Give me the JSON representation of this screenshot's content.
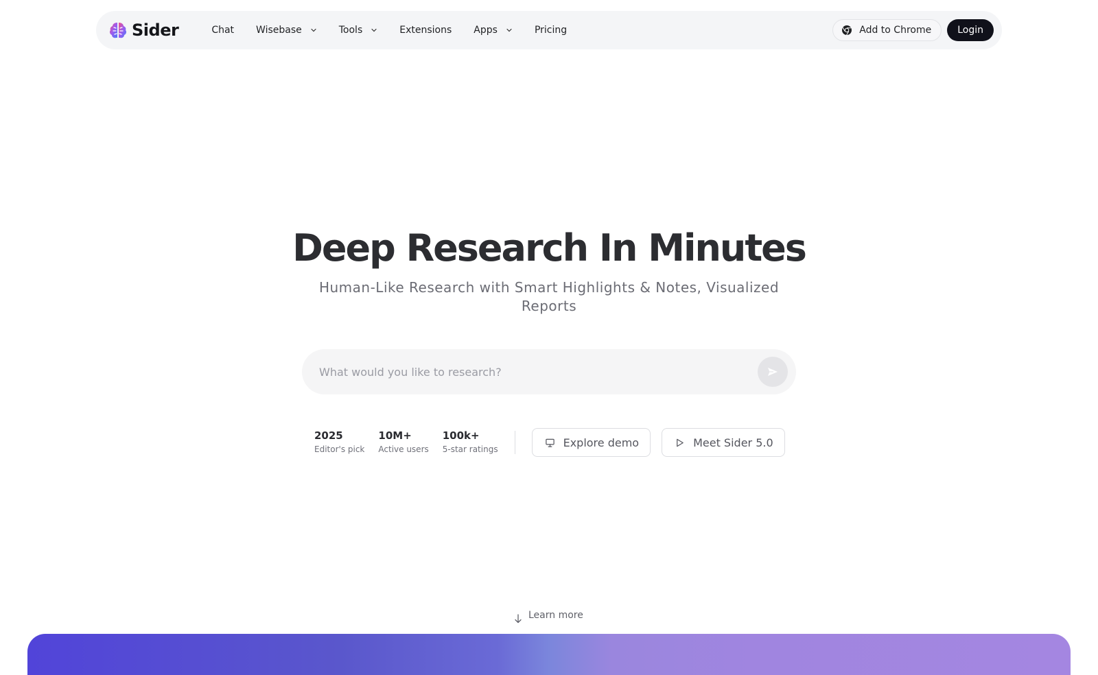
{
  "brand": {
    "name": "Sider",
    "logo_icon": "brain-logo-icon"
  },
  "nav": {
    "items": [
      {
        "label": "Chat",
        "has_dropdown": false
      },
      {
        "label": "Wisebase",
        "has_dropdown": true
      },
      {
        "label": "Tools",
        "has_dropdown": true
      },
      {
        "label": "Extensions",
        "has_dropdown": false
      },
      {
        "label": "Apps",
        "has_dropdown": true
      },
      {
        "label": "Pricing",
        "has_dropdown": false
      }
    ],
    "add_to_chrome": "Add to Chrome",
    "login": "Login"
  },
  "hero": {
    "title": "Deep Research In Minutes",
    "subtitle": "Human-Like Research with Smart Highlights & Notes, Visualized Reports"
  },
  "search": {
    "value": "",
    "placeholder": "What would you like to research?",
    "submit_icon": "send-icon"
  },
  "stats": [
    {
      "value": "2025",
      "label": "Editor's pick"
    },
    {
      "value": "10M+",
      "label": "Active users"
    },
    {
      "value": "100k+",
      "label": "5-star ratings"
    }
  ],
  "actions": {
    "explore_demo": "Explore demo",
    "meet_sider": "Meet Sider 5.0"
  },
  "learn_more": "Learn more",
  "colors": {
    "nav_bg": "#f4f5f7",
    "login_bg": "#10111a",
    "banner_start": "#5144d9",
    "banner_end": "#a486e1"
  }
}
